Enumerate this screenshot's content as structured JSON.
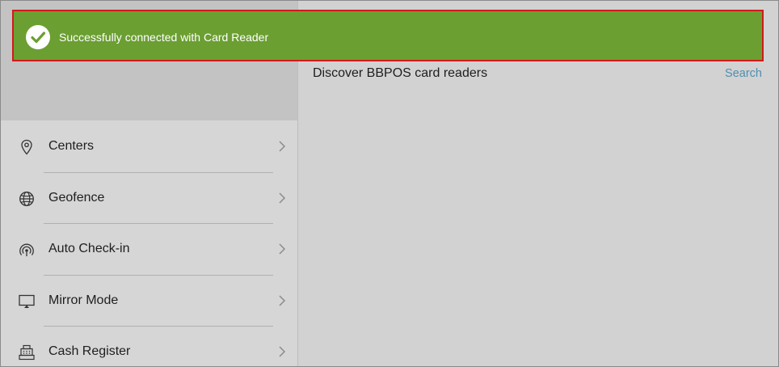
{
  "toast": {
    "message": "Successfully connected with Card Reader",
    "background": "#6b9f32",
    "border": "#d11a1a"
  },
  "main": {
    "title": "Discover BBPOS card readers",
    "search_label": "Search"
  },
  "sidebar": {
    "items": [
      {
        "label": "Centers",
        "icon": "location-pin-icon"
      },
      {
        "label": "Geofence",
        "icon": "globe-icon"
      },
      {
        "label": "Auto Check-in",
        "icon": "signal-waves-icon"
      },
      {
        "label": "Mirror Mode",
        "icon": "monitor-icon"
      },
      {
        "label": "Cash Register",
        "icon": "cash-register-icon"
      }
    ]
  },
  "colors": {
    "link": "#4f8fb0",
    "text": "#1e1e1e",
    "panel": "#d6d6d6"
  }
}
